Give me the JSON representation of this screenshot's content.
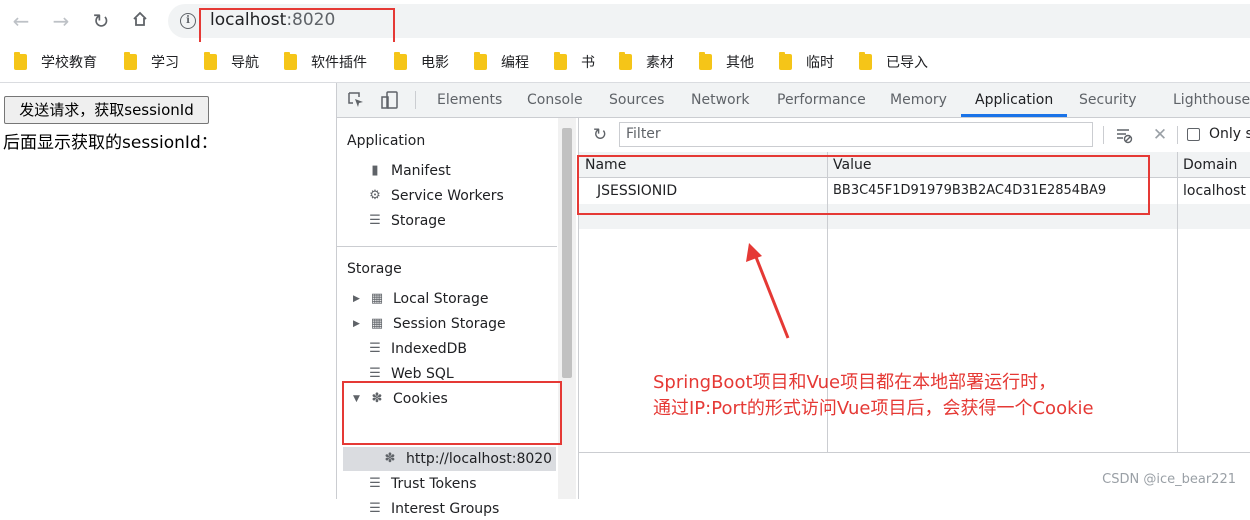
{
  "toolbar": {
    "url_host": "localhost",
    "url_port": ":8020",
    "info_icon": "i"
  },
  "bookmarks": [
    "学校教育",
    "学习",
    "导航",
    "软件插件",
    "电影",
    "编程",
    "书",
    "素材",
    "其他",
    "临时",
    "已导入"
  ],
  "page": {
    "button_label": "发送请求，获取sessionId",
    "text": "后面显示获取的sessionId："
  },
  "devtools": {
    "tabs": [
      "Elements",
      "Console",
      "Sources",
      "Network",
      "Performance",
      "Memory",
      "Application",
      "Security",
      "Lighthouse"
    ],
    "active_tab": "Application",
    "sidebar": {
      "application_header": "Application",
      "application_items": [
        "Manifest",
        "Service Workers",
        "Storage"
      ],
      "storage_header": "Storage",
      "storage_items": [
        "Local Storage",
        "Session Storage",
        "IndexedDB",
        "Web SQL",
        "Cookies"
      ],
      "cookie_origin": "http://localhost:8020",
      "other_items": [
        "Trust Tokens",
        "Interest Groups"
      ]
    },
    "filter_placeholder": "Filter",
    "only_label": "Only sh",
    "columns": [
      "Name",
      "Value",
      "Domain"
    ],
    "rows": [
      {
        "name": "JSESSIONID",
        "value": "BB3C45F1D91979B3B2AC4D31E2854BA9",
        "domain": "localhost"
      }
    ]
  },
  "annotation": {
    "line1": "SpringBoot项目和Vue项目都在本地部署运行时，",
    "line2": "通过IP:Port的形式访问Vue项目后，会获得一个Cookie"
  },
  "watermark": "CSDN @ice_bear221",
  "colors": {
    "highlight": "#e53935",
    "accent": "#1a73e8"
  }
}
